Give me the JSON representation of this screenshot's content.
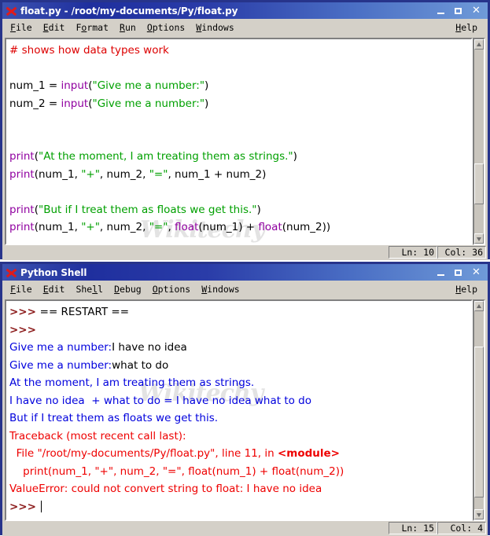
{
  "editor_window": {
    "icon": "python-idle-icon",
    "title": "float.py - /root/my-documents/Py/float.py",
    "buttons": {
      "minimize": "–",
      "maximize": "□",
      "close": "✕"
    },
    "menus": [
      {
        "label": "File",
        "accel": "F"
      },
      {
        "label": "Edit",
        "accel": "E"
      },
      {
        "label": "Format",
        "accel": "o"
      },
      {
        "label": "Run",
        "accel": "R"
      },
      {
        "label": "Options",
        "accel": "O"
      },
      {
        "label": "Windows",
        "accel": "W"
      }
    ],
    "help_menu": {
      "label": "Help",
      "accel": "H"
    },
    "watermark": "Wikitechy",
    "code_lines": [
      [
        {
          "t": "# shows how data types work",
          "c": "comment"
        }
      ],
      [
        {
          "t": "",
          "c": "plain"
        }
      ],
      [
        {
          "t": "num_1 = ",
          "c": "plain"
        },
        {
          "t": "input",
          "c": "kw"
        },
        {
          "t": "(",
          "c": "plain"
        },
        {
          "t": "\"Give me a number:\"",
          "c": "str"
        },
        {
          "t": ")",
          "c": "plain"
        }
      ],
      [
        {
          "t": "num_2 = ",
          "c": "plain"
        },
        {
          "t": "input",
          "c": "kw"
        },
        {
          "t": "(",
          "c": "plain"
        },
        {
          "t": "\"Give me a number:\"",
          "c": "str"
        },
        {
          "t": ")",
          "c": "plain"
        }
      ],
      [
        {
          "t": "",
          "c": "plain"
        }
      ],
      [
        {
          "t": "",
          "c": "plain"
        }
      ],
      [
        {
          "t": "print",
          "c": "kw"
        },
        {
          "t": "(",
          "c": "plain"
        },
        {
          "t": "\"At the moment, I am treating them as strings.\"",
          "c": "str"
        },
        {
          "t": ")",
          "c": "plain"
        }
      ],
      [
        {
          "t": "print",
          "c": "kw"
        },
        {
          "t": "(num_1, ",
          "c": "plain"
        },
        {
          "t": "\"+\"",
          "c": "str"
        },
        {
          "t": ", num_2, ",
          "c": "plain"
        },
        {
          "t": "\"=\"",
          "c": "str"
        },
        {
          "t": ", num_1 + num_2)",
          "c": "plain"
        }
      ],
      [
        {
          "t": "",
          "c": "plain"
        }
      ],
      [
        {
          "t": "print",
          "c": "kw"
        },
        {
          "t": "(",
          "c": "plain"
        },
        {
          "t": "\"But if I treat them as floats we get this.\"",
          "c": "str"
        },
        {
          "t": ")",
          "c": "plain"
        }
      ],
      [
        {
          "t": "print",
          "c": "kw"
        },
        {
          "t": "(num_1, ",
          "c": "plain"
        },
        {
          "t": "\"+\"",
          "c": "str"
        },
        {
          "t": ", num_2, ",
          "c": "plain"
        },
        {
          "t": "\"=\"",
          "c": "str"
        },
        {
          "t": ", ",
          "c": "plain"
        },
        {
          "t": "float",
          "c": "kw"
        },
        {
          "t": "(num_1) + ",
          "c": "plain"
        },
        {
          "t": "float",
          "c": "kw"
        },
        {
          "t": "(num_2))",
          "c": "plain"
        }
      ]
    ],
    "status": {
      "line_label": "Ln: 10",
      "col_label": "Col: 36"
    }
  },
  "shell_window": {
    "icon": "python-idle-icon",
    "title": "Python Shell",
    "buttons": {
      "minimize": "–",
      "maximize": "□",
      "close": "✕"
    },
    "menus": [
      {
        "label": "File",
        "accel": "F"
      },
      {
        "label": "Edit",
        "accel": "E"
      },
      {
        "label": "Shell",
        "accel": "l"
      },
      {
        "label": "Debug",
        "accel": "D"
      },
      {
        "label": "Options",
        "accel": "O"
      },
      {
        "label": "Windows",
        "accel": "W"
      }
    ],
    "help_menu": {
      "label": "Help",
      "accel": "H"
    },
    "watermark": "Wikitechy",
    "output_lines": [
      [
        {
          "t": ">>> ",
          "c": "prompt"
        },
        {
          "t": "== RESTART ==",
          "c": "in"
        }
      ],
      [
        {
          "t": ">>> ",
          "c": "prompt"
        }
      ],
      [
        {
          "t": "Give me a number:",
          "c": "out"
        },
        {
          "t": "I have no idea",
          "c": "in"
        }
      ],
      [
        {
          "t": "Give me a number:",
          "c": "out"
        },
        {
          "t": "what to do",
          "c": "in"
        }
      ],
      [
        {
          "t": "At the moment, I am treating them as strings.",
          "c": "out"
        }
      ],
      [
        {
          "t": "I have no idea  + what to do = I have no idea what to do",
          "c": "out"
        }
      ],
      [
        {
          "t": "But if I treat them as floats we get this.",
          "c": "out"
        }
      ],
      [
        {
          "t": "Traceback (most recent call last):",
          "c": "err"
        }
      ],
      [
        {
          "t": "  File \"/root/my-documents/Py/float.py\", line 11, in ",
          "c": "err"
        },
        {
          "t": "<module>",
          "c": "err bold"
        }
      ],
      [
        {
          "t": "    print(num_1, \"+\", num_2, \"=\", float(num_1) + float(num_2))",
          "c": "err"
        }
      ],
      [
        {
          "t": "ValueError: could not convert string to float: I have no idea",
          "c": "err"
        }
      ],
      [
        {
          "t": ">>> ",
          "c": "prompt",
          "caret": true
        }
      ]
    ],
    "status": {
      "line_label": "Ln: 15",
      "col_label": "Col: 4"
    }
  },
  "colors": {
    "titlebar_blue": "#27348b",
    "frame_blue": "#27348b",
    "chrome_gray": "#d4d0c8",
    "comment_red": "#dd0000",
    "string_green": "#00a000",
    "keyword_purple": "#9000a0",
    "output_blue": "#0000dd",
    "error_red": "#ee0000",
    "prompt_maroon": "#8b1a1a"
  }
}
